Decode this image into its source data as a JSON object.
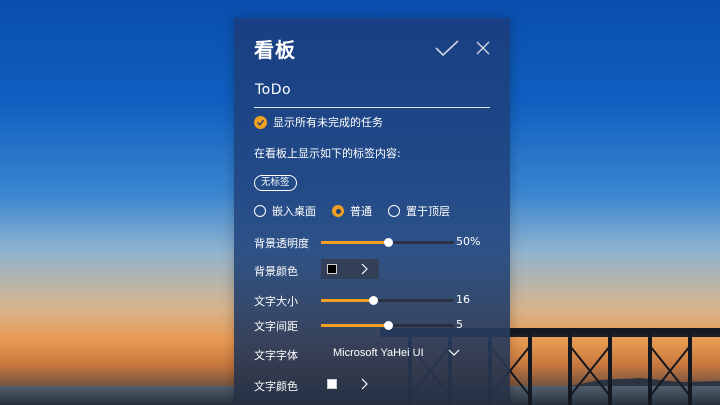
{
  "panel": {
    "title": "看板",
    "todo_name": "ToDo",
    "show_incomplete_label": "显示所有未完成的任务",
    "tags_section_label": "在看板上显示如下的标签内容:",
    "tag_chip": "无标签",
    "layer_options": [
      {
        "label": "嵌入桌面",
        "selected": false
      },
      {
        "label": "普通",
        "selected": true
      },
      {
        "label": "置于顶层",
        "selected": false
      }
    ],
    "bg_opacity": {
      "label": "背景透明度",
      "value": "50%",
      "fraction": 0.5
    },
    "bg_color": {
      "label": "背景颜色",
      "color": "#000000"
    },
    "font_size": {
      "label": "文字大小",
      "value": "16",
      "fraction": 0.39
    },
    "letter_spacing": {
      "label": "文字间距",
      "value": "5",
      "fraction": 0.5
    },
    "font_family": {
      "label": "文字字体",
      "value": "Microsoft YaHei UI"
    },
    "text_color": {
      "label": "文字颜色",
      "color": "#ffffff"
    }
  },
  "icons": {
    "confirm": "check-icon",
    "close": "close-icon",
    "checkbox": "check-circle-icon",
    "chevron_right": "chevron-right-icon",
    "chevron_down": "chevron-down-icon"
  },
  "colors": {
    "accent": "#f0a020"
  }
}
